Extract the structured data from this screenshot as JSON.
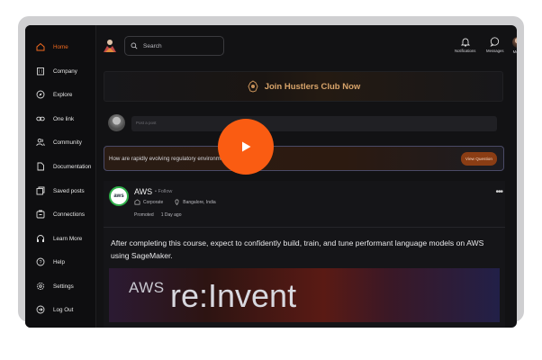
{
  "sidebar": {
    "items": [
      {
        "label": "Home",
        "icon": "home-icon",
        "active": true
      },
      {
        "label": "Company",
        "icon": "building-icon"
      },
      {
        "label": "Explore",
        "icon": "compass-icon"
      },
      {
        "label": "One link",
        "icon": "link-icon"
      },
      {
        "label": "Community",
        "icon": "people-icon"
      },
      {
        "label": "Documentation",
        "icon": "document-icon"
      },
      {
        "label": "Saved posts",
        "icon": "bookmark-icon"
      },
      {
        "label": "Connections",
        "icon": "connections-icon"
      },
      {
        "label": "Learn More",
        "icon": "headphones-icon"
      },
      {
        "label": "Help",
        "icon": "help-icon"
      },
      {
        "label": "Settings",
        "icon": "settings-icon"
      },
      {
        "label": "Log Out",
        "icon": "logout-icon"
      }
    ]
  },
  "header": {
    "search_placeholder": "Search",
    "notifications_label": "Notifications",
    "messages_label": "Messages",
    "me_label": "Me"
  },
  "banner": {
    "text": "Join Hustlers Club Now"
  },
  "composer": {
    "placeholder": "Post a post"
  },
  "question": {
    "text": "How are rapidly evolving regulatory environments, p...",
    "button": "View Question"
  },
  "post": {
    "company": "AWS",
    "follow": "• Follow",
    "type": "Corporate",
    "location": "Bangalore, India",
    "promoted": "Promoted",
    "age": "1 Day ago",
    "body": "After completing this course, expect to confidently build, train, and tune performant language models on AWS using SageMaker.",
    "media_line1": "AWS",
    "media_line2": "re:Invent"
  },
  "colors": {
    "accent": "#f26a1f",
    "play_button": "#fa5c12",
    "background": "#121214"
  }
}
